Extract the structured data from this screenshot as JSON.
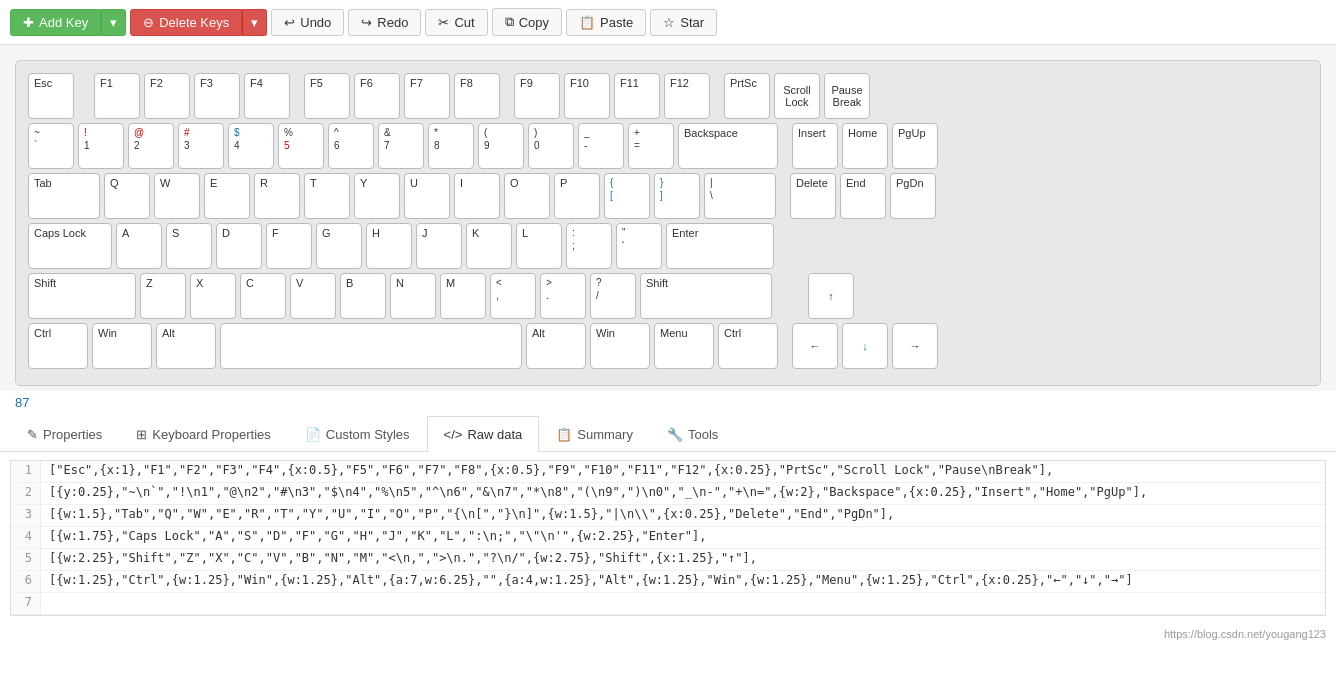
{
  "toolbar": {
    "add_key": "Add Key",
    "delete_keys": "Delete Keys",
    "undo": "Undo",
    "redo": "Redo",
    "cut": "Cut",
    "copy": "Copy",
    "paste": "Paste",
    "star": "Star"
  },
  "keyboard": {
    "key_count": "87"
  },
  "tabs": [
    {
      "id": "properties",
      "label": "Properties",
      "icon": "edit"
    },
    {
      "id": "keyboard-properties",
      "label": "Keyboard Properties",
      "icon": "table"
    },
    {
      "id": "custom-styles",
      "label": "Custom Styles",
      "icon": "file"
    },
    {
      "id": "raw-data",
      "label": "Raw data",
      "icon": "code",
      "active": true
    },
    {
      "id": "summary",
      "label": "Summary",
      "icon": "file"
    },
    {
      "id": "tools",
      "label": "Tools",
      "icon": "wrench"
    }
  ],
  "code_lines": [
    {
      "num": "1",
      "content": "[\"Esc\",{x:1},\"F1\",\"F2\",\"F3\",\"F4\",{x:0.5},\"F5\",\"F6\",\"F7\",\"F8\",{x:0.5},\"F9\",\"F10\",\"F11\",\"F12\",{x:0.25},\"PrtSc\",\"Scroll Lock\",\"Pause\\nBreak\"],"
    },
    {
      "num": "2",
      "content": "[{y:0.25},\"~\\n`\",\"!\\n1\",\"@\\n2\",\"#\\n3\",\"$\\n4\",\"%\\n5\",\"^\\n6\",\"&\\n7\",\"*\\n8\",\"(\\n9\",\")\\n0\",\"_\\n-\",\"+\\n=\",{w:2},\"Backspace\",{x:0.25},\"Insert\",\"Home\",\"PgUp\"],"
    },
    {
      "num": "3",
      "content": "[{w:1.5},\"Tab\",\"Q\",\"W\",\"E\",\"R\",\"T\",\"Y\",\"U\",\"I\",\"O\",\"P\",\"{\\n[\",\"}\\n]\",{w:1.5},\"|\\n\\\\\",{x:0.25},\"Delete\",\"End\",\"PgDn\"],"
    },
    {
      "num": "4",
      "content": "[{w:1.75},\"Caps Lock\",\"A\",\"S\",\"D\",\"F\",\"G\",\"H\",\"J\",\"K\",\"L\",\":\\n;\",\"\\\"\\n'\",{w:2.25},\"Enter\"],"
    },
    {
      "num": "5",
      "content": "[{w:2.25},\"Shift\",\"Z\",\"X\",\"C\",\"V\",\"B\",\"N\",\"M\",\"<\\n,\",\">\\n.\",\"?\\n/\",{w:2.75},\"Shift\",{x:1.25},\"↑\"],"
    },
    {
      "num": "6",
      "content": "[{w:1.25},\"Ctrl\",{w:1.25},\"Win\",{w:1.25},\"Alt\",{a:7,w:6.25},\"\",{a:4,w:1.25},\"Alt\",{w:1.25},\"Win\",{w:1.25},\"Menu\",{w:1.25},\"Ctrl\",{x:0.25},\"←\",\"↓\",\"→\"]"
    },
    {
      "num": "7",
      "content": ""
    }
  ],
  "watermark": "https://blog.csdn.net/yougang123"
}
